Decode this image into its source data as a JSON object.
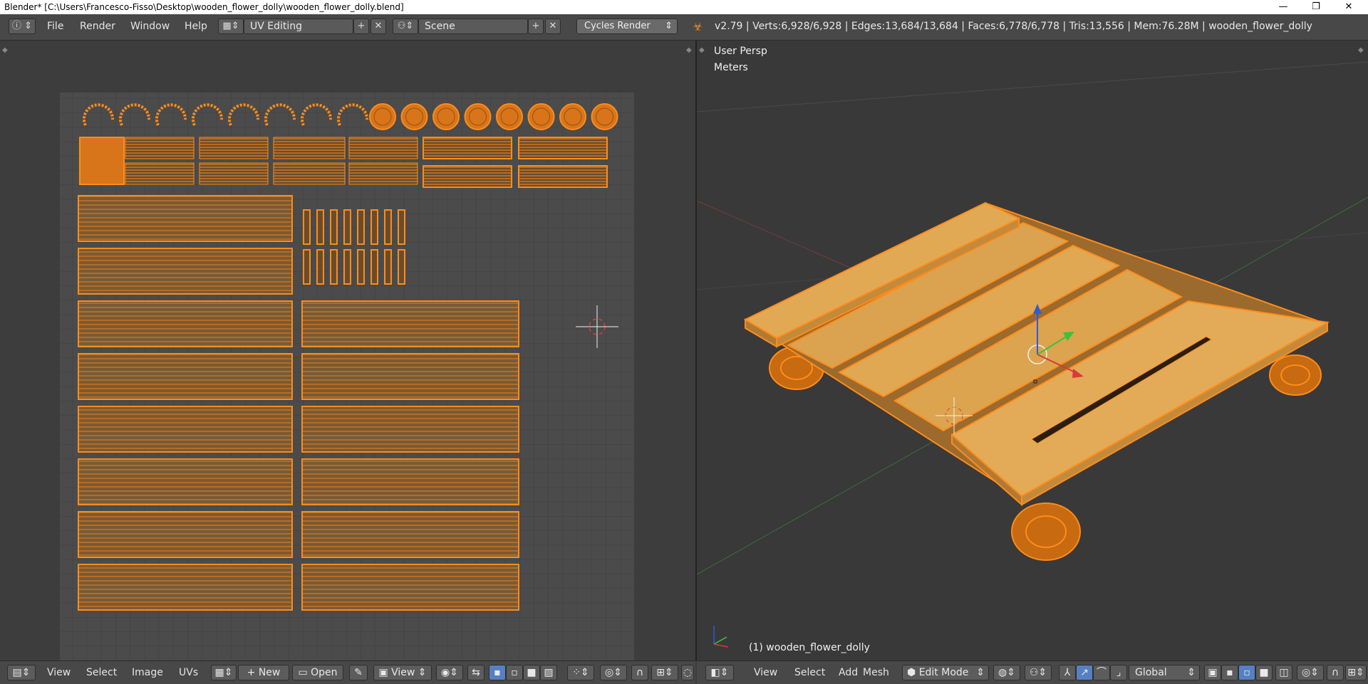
{
  "window": {
    "title": "Blender* [C:\\Users\\Francesco-Fisso\\Desktop\\wooden_flower_dolly\\wooden_flower_dolly.blend]",
    "minimize_glyph": "—",
    "restore_glyph": "❐",
    "close_glyph": "✕"
  },
  "info_header": {
    "editor_icon": "info-icon",
    "menus": [
      "File",
      "Render",
      "Window",
      "Help"
    ],
    "screen_layout": "UV Editing",
    "scene": "Scene",
    "render_engine": "Cycles Render",
    "stats": "v2.79 | Verts:6,928/6,928 | Edges:13,684/13,684 | Faces:6,778/6,778 | Tris:13,556 | Mem:76.28M | wooden_flower_dolly"
  },
  "viewport": {
    "view_name": "User Persp",
    "units": "Meters",
    "object_label": "(1) wooden_flower_dolly"
  },
  "uv_footer": {
    "menus": [
      "View",
      "Select",
      "Image",
      "UVs"
    ],
    "new_label": "New",
    "open_label": "Open",
    "view_label": "View"
  },
  "view3d_footer": {
    "menus": [
      "View",
      "Select",
      "Add",
      "Mesh"
    ],
    "mode": "Edit Mode",
    "orientation": "Global"
  },
  "colors": {
    "selection": "#ff8c1a",
    "wood": "#d9a14a",
    "uv_grid_bg": "#4a4a4a",
    "header_bg": "#484848"
  }
}
